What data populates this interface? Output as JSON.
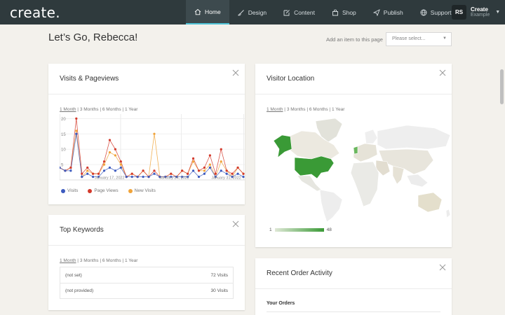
{
  "app": {
    "logo_text": "create",
    "nav": [
      {
        "label": "Home",
        "icon": "home-icon",
        "active": true
      },
      {
        "label": "Design",
        "icon": "brush-icon",
        "active": false
      },
      {
        "label": "Content",
        "icon": "edit-icon",
        "active": false
      },
      {
        "label": "Shop",
        "icon": "bag-icon",
        "active": false
      },
      {
        "label": "Publish",
        "icon": "send-icon",
        "active": false
      },
      {
        "label": "Support",
        "icon": "globe-icon",
        "active": false
      }
    ],
    "account": {
      "initials": "RS",
      "name": "Create",
      "subtitle": "Example"
    }
  },
  "header": {
    "greeting": "Let’s Go, Rebecca!",
    "add_item_label": "Add an item to this page",
    "select_placeholder": "Please select..."
  },
  "colors": {
    "topbar": "#2f3a3d",
    "active_accent": "#4ec3d6",
    "visits": "#3d5bbf",
    "page_views": "#d33a2c",
    "new_visits": "#f0a43a",
    "map_high": "#3a9a36"
  },
  "visits_card": {
    "title": "Visits & Pageviews",
    "ranges": [
      "1 Month",
      "3 Months",
      "6 Months",
      "1 Year"
    ],
    "selected_range": "1 Month",
    "chart_data": {
      "type": "line",
      "x_tick_labels": [
        "January 17, 2022",
        "January 24, 2022",
        "January 31, 2022"
      ],
      "y_ticks": [
        5,
        10,
        15,
        20
      ],
      "ylim": [
        0,
        21
      ],
      "series": [
        {
          "name": "Visits",
          "color": "#3d5bbf",
          "values": [
            4,
            3,
            3,
            15,
            1,
            2,
            1,
            1,
            3,
            4,
            3,
            4,
            1,
            1,
            1,
            1,
            1,
            2,
            1,
            1,
            1,
            1,
            1,
            1,
            3,
            1,
            2,
            4,
            1,
            3,
            2,
            1,
            2,
            1
          ]
        },
        {
          "name": "Page Views",
          "color": "#d33a2c",
          "values": [
            4,
            3,
            4,
            20,
            2,
            4,
            2,
            2,
            6,
            13,
            10,
            6,
            1,
            2,
            1,
            3,
            1,
            3,
            1,
            1,
            2,
            1,
            3,
            2,
            7,
            3,
            4,
            8,
            2,
            10,
            3,
            2,
            4,
            2
          ]
        },
        {
          "name": "New Visits",
          "color": "#f0a43a",
          "values": [
            4,
            3,
            4,
            16,
            1,
            3,
            2,
            2,
            5,
            9,
            8,
            5,
            1,
            2,
            1,
            3,
            1,
            15,
            1,
            1,
            2,
            1,
            3,
            2,
            6,
            3,
            3,
            5,
            1,
            6,
            3,
            1,
            4,
            2
          ]
        }
      ]
    }
  },
  "keywords_card": {
    "title": "Top Keywords",
    "ranges": [
      "1 Month",
      "3 Months",
      "6 Months",
      "1 Year"
    ],
    "selected_range": "1 Month",
    "rows": [
      {
        "keyword": "(not set)",
        "visits": "72 Visits"
      },
      {
        "keyword": "(not provided)",
        "visits": "30 Visits"
      }
    ]
  },
  "location_card": {
    "title": "Visitor Location",
    "ranges": [
      "1 Month",
      "3 Months",
      "6 Months",
      "1 Year"
    ],
    "selected_range": "1 Month",
    "scale_min": "1",
    "scale_max": "48"
  },
  "orders_card": {
    "title": "Recent Order Activity",
    "section_label": "Your Orders"
  }
}
